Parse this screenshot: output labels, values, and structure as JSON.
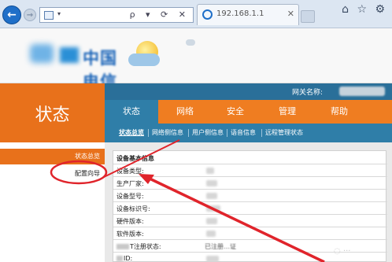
{
  "browser": {
    "tab_title": "192.168.1.1",
    "address_dropdown": "▾",
    "address_tools": "ρ ▾ ⟳ ✕",
    "tab_close": "✕",
    "toolbar_glyphs": "⌂ ☆ ⚙"
  },
  "header": {
    "status_title": "状态",
    "gateway_label": "网关名称:"
  },
  "menu": {
    "items": [
      {
        "label": "状态",
        "active": true
      },
      {
        "label": "网络",
        "active": false
      },
      {
        "label": "安全",
        "active": false
      },
      {
        "label": "管理",
        "active": false
      },
      {
        "label": "帮助",
        "active": false
      }
    ]
  },
  "submenu": {
    "items": [
      {
        "label": "状态总览",
        "active": true
      },
      {
        "label": "网络侧信息",
        "active": false
      },
      {
        "label": "用户侧信息",
        "active": false
      },
      {
        "label": "语音信息",
        "active": false
      },
      {
        "label": "远程管理状态",
        "active": false
      }
    ]
  },
  "sidebar": {
    "active_label": "状态总览",
    "item_label": "配置向导"
  },
  "device_info": {
    "section_title": "设备基本信息",
    "rows": [
      {
        "label": "设备类型:"
      },
      {
        "label": "生产厂家:"
      },
      {
        "label": "设备型号:"
      },
      {
        "label": "设备标识号:"
      },
      {
        "label": "硬件版本:"
      },
      {
        "label": "软件版本:"
      },
      {
        "label": "T注册状态:",
        "value": "已注册…证"
      },
      {
        "label": "ID:"
      }
    ]
  },
  "colors": {
    "orange": "#e8711b",
    "menu_orange": "#ef7d21",
    "blue": "#2f7ea8",
    "annotation_red": "#e0242b"
  }
}
